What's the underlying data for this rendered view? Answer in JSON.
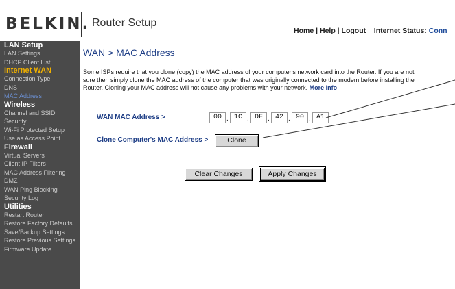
{
  "brand": {
    "logo": "BELKIN.",
    "app_title": "Router Setup"
  },
  "top_links": {
    "home": "Home",
    "help": "Help",
    "logout": "Logout",
    "sep": "|",
    "status_label": "Internet Status:",
    "status_value": "Conn"
  },
  "sidebar": [
    {
      "heading": "LAN Setup",
      "active": false,
      "items": [
        {
          "label": "LAN Settings",
          "active": false
        },
        {
          "label": "DHCP Client List",
          "active": false
        }
      ]
    },
    {
      "heading": "Internet WAN",
      "active": true,
      "items": [
        {
          "label": "Connection Type",
          "active": false
        },
        {
          "label": "DNS",
          "active": false
        },
        {
          "label": "MAC Address",
          "active": true
        }
      ]
    },
    {
      "heading": "Wireless",
      "active": false,
      "items": [
        {
          "label": "Channel and SSID",
          "active": false
        },
        {
          "label": "Security",
          "active": false
        },
        {
          "label": "Wi-Fi Protected Setup",
          "active": false
        },
        {
          "label": "Use as Access Point",
          "active": false
        }
      ]
    },
    {
      "heading": "Firewall",
      "active": false,
      "items": [
        {
          "label": "Virtual Servers",
          "active": false
        },
        {
          "label": "Client IP Filters",
          "active": false
        },
        {
          "label": "MAC Address Filtering",
          "active": false
        },
        {
          "label": "DMZ",
          "active": false
        },
        {
          "label": "WAN Ping Blocking",
          "active": false
        },
        {
          "label": "Security Log",
          "active": false
        }
      ]
    },
    {
      "heading": "Utilities",
      "active": false,
      "items": [
        {
          "label": "Restart Router",
          "active": false
        },
        {
          "label": "Restore Factory Defaults",
          "active": false
        },
        {
          "label": "Save/Backup Settings",
          "active": false
        },
        {
          "label": "Restore Previous Settings",
          "active": false
        },
        {
          "label": "Firmware Update",
          "active": false
        }
      ]
    }
  ],
  "main": {
    "title": "WAN > MAC Address",
    "description": "Some ISPs require that you clone (copy) the MAC address of your computer's network card into the Router. If you are not sure then simply clone the MAC address of the computer that was originally connected to the modem before installing the Router. Cloning your MAC address will not cause any problems with your network.",
    "more_info": "More Info",
    "wan_mac_label": "WAN MAC Address >",
    "mac_octets": [
      "00",
      "1C",
      "DF",
      "42",
      "90",
      "A1"
    ],
    "mac_separator": ".",
    "clone_label": "Clone Computer's MAC Address >",
    "clone_button": "Clone",
    "clear_button": "Clear Changes",
    "apply_button": "Apply Changes"
  }
}
